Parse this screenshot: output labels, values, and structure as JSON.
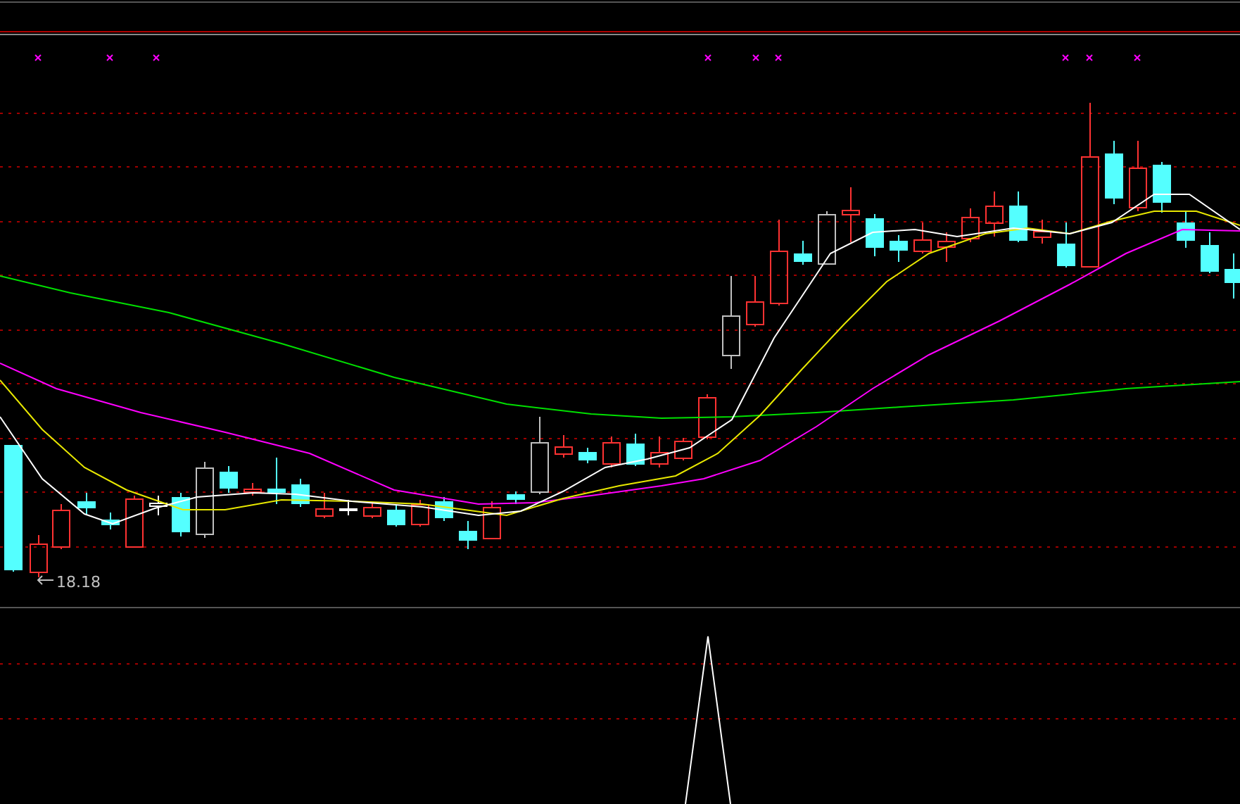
{
  "chart": {
    "low_label": "18.18"
  }
}
